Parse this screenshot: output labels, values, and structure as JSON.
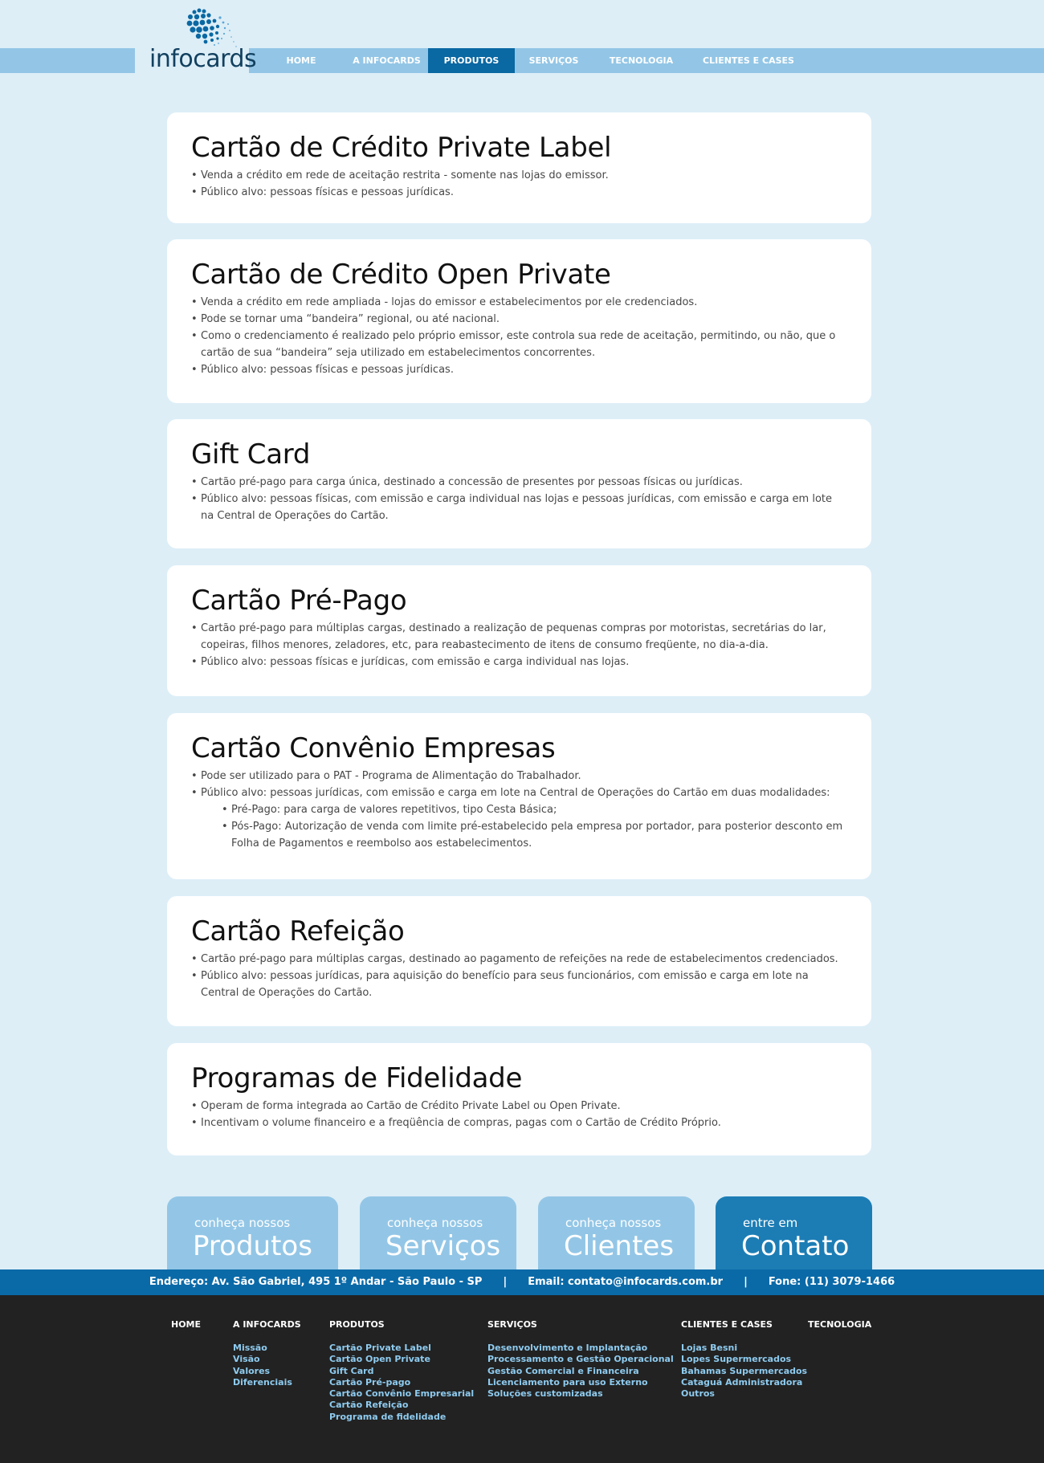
{
  "logo": {
    "text": "infocards"
  },
  "nav": [
    {
      "label": "HOME",
      "active": false
    },
    {
      "label": "A INFOCARDS",
      "active": false
    },
    {
      "label": "PRODUTOS",
      "active": true
    },
    {
      "label": "SERVIÇOS",
      "active": false
    },
    {
      "label": "TECNOLOGIA",
      "active": false
    },
    {
      "label": "CLIENTES E CASES",
      "active": false
    }
  ],
  "products": [
    {
      "title": "Cartão de Crédito Private Label",
      "bullets": [
        "Venda a crédito em rede de aceitação restrita - somente nas lojas do emissor.",
        "Público alvo: pessoas físicas e pessoas jurídicas."
      ]
    },
    {
      "title": "Cartão de Crédito Open Private",
      "bullets": [
        "Venda a crédito em rede ampliada - lojas do emissor e estabelecimentos por ele credenciados.",
        "Pode se tornar uma “bandeira” regional, ou até nacional.",
        "Como o credenciamento é realizado pelo próprio emissor, este controla sua rede de aceitação, permitindo, ou não, que o cartão de sua “bandeira” seja utilizado em estabelecimentos concorrentes.",
        "Público alvo: pessoas físicas e pessoas jurídicas."
      ]
    },
    {
      "title": "Gift Card",
      "bullets": [
        "Cartão pré-pago para carga única, destinado a concessão de presentes por pessoas físicas ou jurídicas.",
        "Público alvo: pessoas físicas, com emissão e carga individual nas lojas e pessoas jurídicas, com emissão e carga em lote na Central de Operações do Cartão."
      ]
    },
    {
      "title": "Cartão Pré-Pago",
      "bullets": [
        "Cartão pré-pago para múltiplas cargas, destinado a realização de pequenas compras por motoristas, secretárias do lar, copeiras, filhos menores, zeladores, etc, para reabastecimento de itens de consumo freqüente, no dia-a-dia.",
        "Público alvo: pessoas físicas e jurídicas, com emissão e carga individual nas lojas."
      ]
    },
    {
      "title": "Cartão Convênio Empresas",
      "bullets": [
        "Pode ser utilizado para o PAT - Programa de Alimentação do Trabalhador.",
        "Público alvo: pessoas jurídicas, com emissão e carga em lote na Central de Operações do Cartão em duas modalidades:"
      ],
      "sub_bullets": [
        "Pré-Pago: para carga de valores repetitivos, tipo Cesta Básica;",
        "Pós-Pago: Autorização de venda com limite pré-estabelecido pela empresa por portador, para posterior desconto em Folha de Pagamentos e reembolso aos estabelecimentos."
      ]
    },
    {
      "title": "Cartão Refeição",
      "bullets": [
        "Cartão pré-pago para múltiplas cargas, destinado ao pagamento de refeições na rede de estabelecimentos credenciados.",
        "Público alvo: pessoas jurídicas, para aquisição do benefício para seus funcionários, com emissão e carga em lote na Central de Operações do Cartão."
      ]
    },
    {
      "title": "Programas de Fidelidade",
      "bullets": [
        "Operam de forma integrada ao Cartão de Crédito Private Label ou Open Private.",
        "Incentivam o volume financeiro e a freqüência de compras, pagas com o Cartão de Crédito Próprio."
      ]
    }
  ],
  "cta": [
    {
      "small": "conheça nossos",
      "big": "Produtos"
    },
    {
      "small": "conheça nossos",
      "big": "Serviços"
    },
    {
      "small": "conheça nossos",
      "big": "Clientes"
    },
    {
      "small": "entre em",
      "big": "Contato"
    }
  ],
  "info": {
    "address": "Endereço: Av. São Gabriel, 495 1º Andar - São Paulo - SP",
    "email": "Email: contato@infocards.com.br",
    "phone": "Fone: (11) 3079-1466",
    "separator": "|"
  },
  "footer": {
    "columns": [
      {
        "heading": "HOME",
        "links": []
      },
      {
        "heading": "A INFOCARDS",
        "links": [
          "Missão",
          "Visão",
          "Valores",
          "Diferenciais"
        ]
      },
      {
        "heading": "PRODUTOS",
        "links": [
          "Cartão Private Label",
          "Cartão Open Private",
          "Gift Card",
          "Cartão Pré-pago",
          "Cartão Convênio Empresarial",
          "Cartão Refeição",
          "Programa de fidelidade"
        ]
      },
      {
        "heading": "SERVIÇOS",
        "links": [
          "Desenvolvimento e Implantação",
          "Processamento e Gestão Operacional",
          "Gestão Comercial e Financeira",
          "Licenciamento para uso Externo",
          "Soluções customizadas"
        ]
      },
      {
        "heading": "CLIENTES E CASES",
        "links": [
          "Lojas Besni",
          "Lopes Supermercados",
          "Bahamas Supermercados",
          "Cataguá Administradora",
          "Outros"
        ]
      },
      {
        "heading": "TECNOLOGIA",
        "links": []
      }
    ]
  },
  "colors": {
    "page_bg": "#ddeef7",
    "nav_bar": "#93c6e6",
    "nav_active": "#0a68a2",
    "cta_light": "#93c6e6",
    "cta_dark": "#1c7db5",
    "footer_bg": "#222222",
    "footer_link": "#8ecbef"
  }
}
